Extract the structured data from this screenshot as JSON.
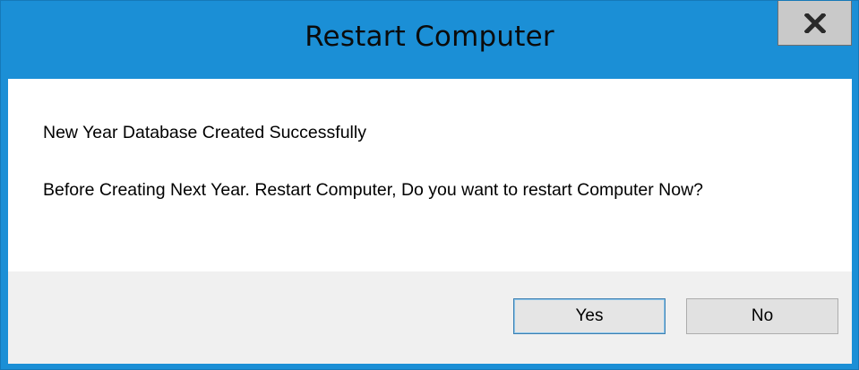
{
  "window": {
    "title": "Restart Computer",
    "close_icon": "close-icon"
  },
  "message": {
    "line1": "New Year Database Created Successfully",
    "line2": "Before Creating Next Year. Restart Computer, Do you want to restart Computer Now?"
  },
  "buttons": {
    "yes_label": "Yes",
    "no_label": "No"
  },
  "colors": {
    "titlebar": "#1b8fd6",
    "close_button": "#c9c9c9",
    "footer": "#f0f0f0",
    "button_face": "#e1e1e1",
    "default_button_border": "#3c7fb1"
  }
}
